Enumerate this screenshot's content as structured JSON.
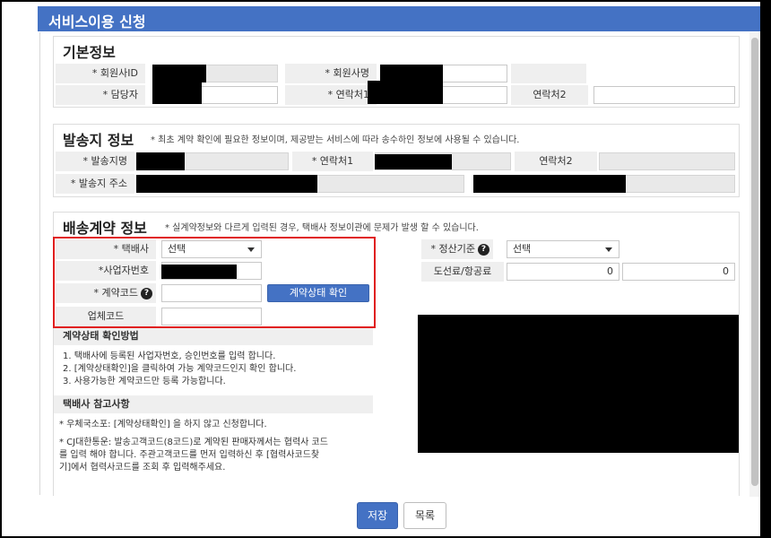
{
  "window": {
    "title": "서비스이용 신청"
  },
  "basic_info": {
    "title": "기본정보",
    "member_id_label": "* 회원사ID",
    "member_name_label": "* 회원사명",
    "manager_label": "* 담당자",
    "contact1_label": "* 연락처1",
    "contact2_label": "연락처2"
  },
  "origin_info": {
    "title": "발송지 정보",
    "note": "* 최초 계약 확인에 필요한 정보이며, 제공받는 서비스에 따라 송수하인 정보에 사용될 수 있습니다.",
    "origin_name_label": "* 발송지명",
    "contact1_label": "* 연락처1",
    "contact2_label": "연락처2",
    "address_label": "* 발송지 주소"
  },
  "contract_info": {
    "title": "배송계약 정보",
    "note": "* 실계약정보와 다르게 입력된 경우, 택배사 정보이관에 문제가 발생 할 수 있습니다.",
    "courier_label": "* 택배사",
    "courier_value": "선택",
    "biz_no_label": "*사업자번호",
    "contract_code_label": "* 계약코드",
    "contract_check_button": "계약상태 확인",
    "business_code_label": "업체코드",
    "settlement_label": "* 정산기준",
    "settlement_value": "선택",
    "fee_label": "도선료/항공료",
    "fee_value1": "0",
    "fee_value2": "0"
  },
  "help": {
    "check_title": "계약상태 확인방법",
    "check_line1": "1. 택배사에 등록된 사업자번호, 승인번호를 입력 합니다.",
    "check_line2": "2. [계약상태확인]을 클릭하여 가능 계약코드인지 확인 합니다.",
    "check_line3": "3. 사용가능한 계약코드만 등록 가능합니다.",
    "ref_title": "택배사 참고사항",
    "ref_line1": "* 우체국소포: [계약상태확인] 을 하지 않고 신청합니다.",
    "ref_line2": "* CJ대한통운: 발송고객코드(8코드)로 계약된 판매자께서는 협력사 코드",
    "ref_line3": "를 입력 해야 합니다. 주관고객코드를 먼저 입력하신 후 [협력사코드찾",
    "ref_line4": "기]에서 협력사코드를 조회 후 입력해주세요."
  },
  "footer": {
    "save_button": "저장",
    "list_button": "목록"
  },
  "colors": {
    "brand": "#4472c4",
    "highlight_border": "#e01e1e"
  }
}
